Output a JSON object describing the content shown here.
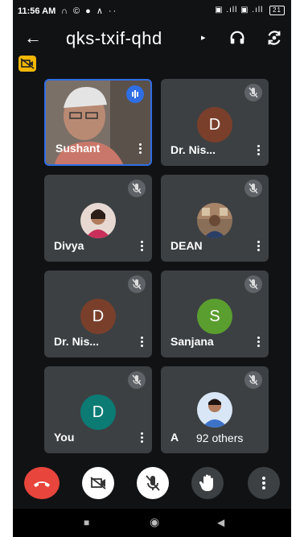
{
  "status": {
    "time": "11:56 AM",
    "left_icons": "∩ © ● ∧ ··",
    "right_icons": "▣ .ıll ▣ .ıll",
    "battery": "21"
  },
  "header": {
    "meeting_code": "qks-txif-qhd",
    "caret": "▸"
  },
  "participants": [
    {
      "name": "Sushant",
      "type": "video"
    },
    {
      "name": "Dr. Nis...",
      "type": "letter",
      "initial": "D",
      "color": "#7a3f2b"
    },
    {
      "name": "Divya",
      "type": "photo"
    },
    {
      "name": "DEAN",
      "type": "photo"
    },
    {
      "name": "Dr. Nis...",
      "type": "letter",
      "initial": "D",
      "color": "#7a3f2b"
    },
    {
      "name": "Sanjana",
      "type": "letter",
      "initial": "S",
      "color": "#5a9e2f"
    },
    {
      "name": "You",
      "type": "letter",
      "initial": "D",
      "color": "#0b7b74"
    },
    {
      "name": "A",
      "type": "photo",
      "others": "92 others"
    }
  ],
  "colors": {
    "end_call": "#e8453c",
    "active_border": "#2f6ee5",
    "badge_yellow": "#f2b705"
  },
  "icons": [
    "back-arrow-icon",
    "headphones-icon",
    "switch-camera-icon",
    "camera-off-icon",
    "mic-off-icon",
    "speaking-icon",
    "more-vert-icon",
    "end-call-icon",
    "raise-hand-icon"
  ]
}
